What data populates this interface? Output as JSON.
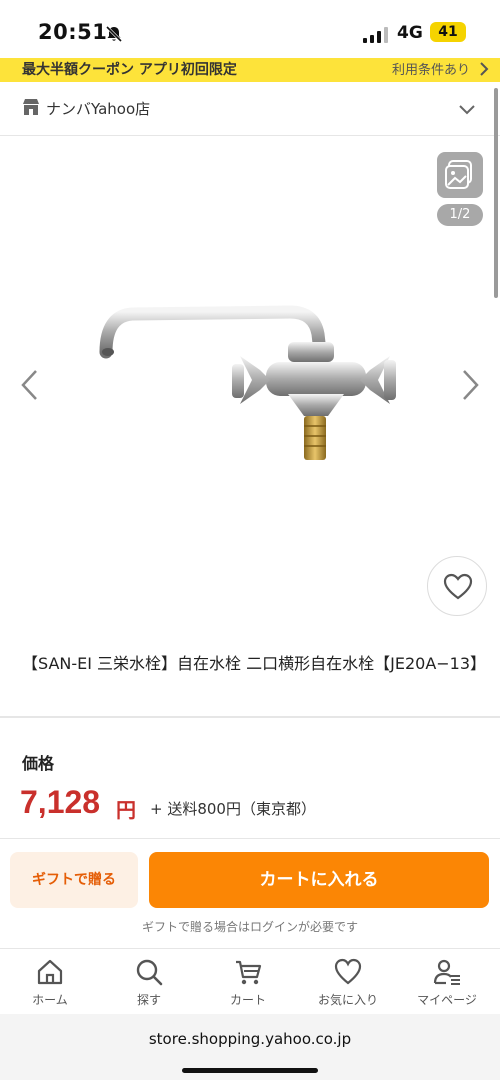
{
  "status": {
    "time": "20:51",
    "network": "4G",
    "battery": "41"
  },
  "banner": {
    "text": "最大半額クーポン アプリ初回限定",
    "link": "利用条件あり"
  },
  "store": {
    "name": "ナンバYahoo店"
  },
  "gallery": {
    "indicator": "1/2"
  },
  "product": {
    "title": "【SAN-EI 三栄水栓】自在水栓 二口横形自在水栓【JE20A−13】",
    "price_label": "価格",
    "price": "7,128",
    "currency": "円",
    "shipping": "+ 送料800円（東京都）"
  },
  "actions": {
    "gift_label": "ギフトで贈る",
    "cart_label": "カートに入れる",
    "gift_note": "ギフトで贈る場合はログインが必要です"
  },
  "nav": [
    {
      "label": "ホーム",
      "icon": "home-icon"
    },
    {
      "label": "探す",
      "icon": "search-icon"
    },
    {
      "label": "カート",
      "icon": "cart-icon"
    },
    {
      "label": "お気に入り",
      "icon": "heart-icon"
    },
    {
      "label": "マイページ",
      "icon": "user-icon"
    }
  ],
  "url": "store.shopping.yahoo.co.jp",
  "colors": {
    "banner": "#fde33a",
    "price": "#c9302c",
    "cart_button": "#fb8605",
    "gift_button_bg": "#fdf0e4"
  }
}
